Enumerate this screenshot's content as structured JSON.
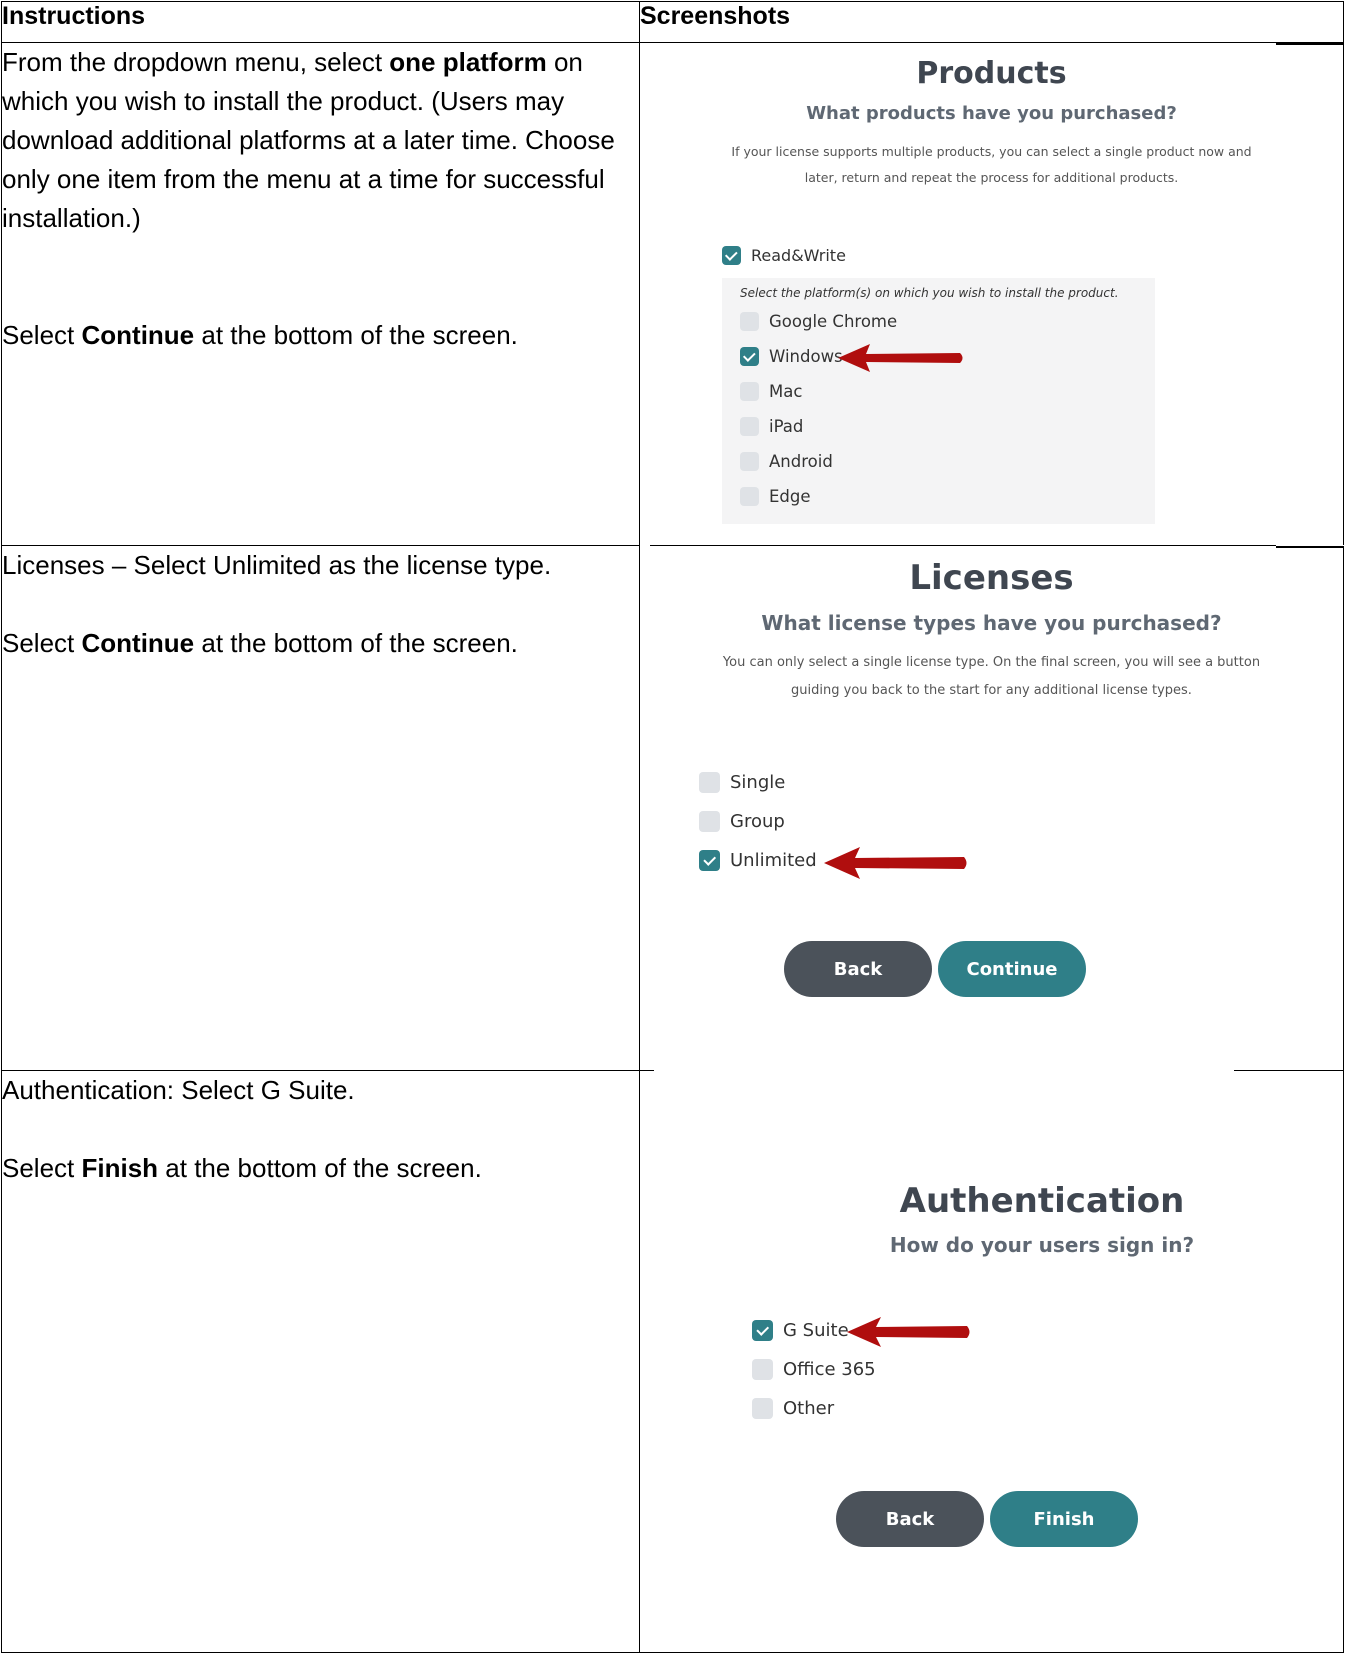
{
  "table": {
    "headers": {
      "instructions": "Instructions",
      "screenshots": "Screenshots"
    },
    "rows": [
      {
        "instruction_parts": [
          "From the dropdown menu, select ",
          "one platform",
          " on which you wish to install the product. (Users may download additional platforms at a later time. Choose only one item from the menu at a time for successful installation.)"
        ],
        "continue_parts": [
          "Select ",
          "Continue",
          " at the bottom of the screen."
        ]
      },
      {
        "instruction": "Licenses – Select Unlimited as the license type.",
        "continue_parts": [
          "Select ",
          "Continue",
          " at the bottom of the screen."
        ]
      },
      {
        "instruction": "Authentication: Select G Suite.",
        "finish_parts": [
          "Select ",
          "Finish",
          " at the bottom of the screen."
        ]
      }
    ]
  },
  "products_screen": {
    "title": "Products",
    "subtitle": "What products have you purchased?",
    "description_line1": "If your license supports multiple products, you can select a single product now and",
    "description_line2": "later, return and repeat the process for additional products.",
    "product": {
      "label": "Read&Write",
      "checked": true
    },
    "platform_prompt": "Select the platform(s) on which you wish to install the product.",
    "platforms": [
      {
        "label": "Google Chrome",
        "checked": false
      },
      {
        "label": "Windows",
        "checked": true
      },
      {
        "label": "Mac",
        "checked": false
      },
      {
        "label": "iPad",
        "checked": false
      },
      {
        "label": "Android",
        "checked": false
      },
      {
        "label": "Edge",
        "checked": false
      }
    ]
  },
  "licenses_screen": {
    "title": "Licenses",
    "subtitle": "What license types have you purchased?",
    "description_line1": "You can only select a single license type. On the final screen, you will see a button",
    "description_line2": "guiding you back to the start for any additional license types.",
    "options": [
      {
        "label": "Single",
        "checked": false
      },
      {
        "label": "Group",
        "checked": false
      },
      {
        "label": "Unlimited",
        "checked": true
      }
    ],
    "back_label": "Back",
    "continue_label": "Continue"
  },
  "auth_screen": {
    "title": "Authentication",
    "subtitle": "How do your users sign in?",
    "options": [
      {
        "label": "G Suite",
        "checked": true
      },
      {
        "label": "Office 365",
        "checked": false
      },
      {
        "label": "Other",
        "checked": false
      }
    ],
    "back_label": "Back",
    "finish_label": "Finish"
  },
  "colors": {
    "teal": "#2f7f88",
    "dark_button": "#4b525a",
    "arrow_red": "#b00e0e",
    "checkbox_off": "#dfe2e6"
  }
}
